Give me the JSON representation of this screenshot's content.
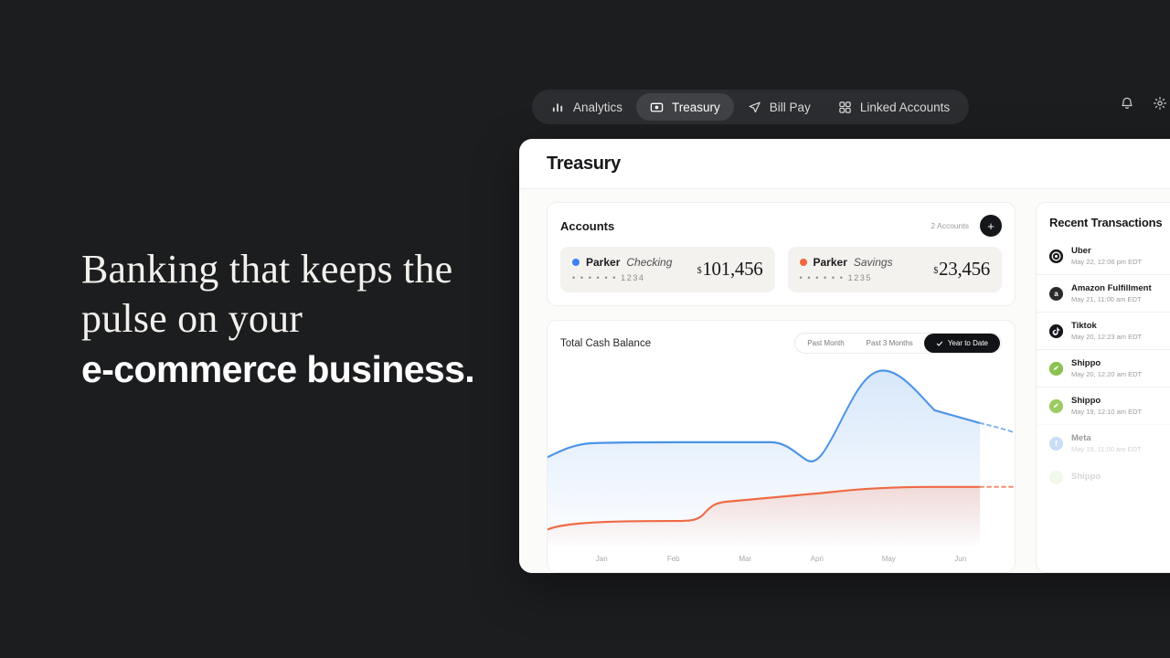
{
  "hero": {
    "line1": "Banking that keeps the",
    "line2": "pulse on your",
    "line3": "e-commerce business."
  },
  "nav": {
    "items": [
      {
        "label": "Analytics",
        "icon": "bar-chart-icon",
        "active": false
      },
      {
        "label": "Treasury",
        "icon": "card-icon",
        "active": true
      },
      {
        "label": "Bill Pay",
        "icon": "send-icon",
        "active": false
      },
      {
        "label": "Linked Accounts",
        "icon": "grid-icon",
        "active": false
      }
    ],
    "actions": [
      {
        "name": "notifications-button",
        "icon": "bell-icon"
      },
      {
        "name": "settings-button",
        "icon": "gear-icon"
      }
    ]
  },
  "page": {
    "title": "Treasury"
  },
  "accounts": {
    "heading": "Accounts",
    "count_label": "2 Accounts",
    "add_label": "+",
    "items": [
      {
        "owner": "Parker",
        "type": "Checking",
        "mask": "• • • • • • 1234",
        "currency": "$",
        "amount": "101,456",
        "color": "#3b82f6"
      },
      {
        "owner": "Parker",
        "type": "Savings",
        "mask": "• • • • • • 1235",
        "currency": "$",
        "amount": "23,456",
        "color": "#f4653c"
      }
    ]
  },
  "chart_data": {
    "type": "area",
    "title": "Total Cash Balance",
    "xlabel": "",
    "ylabel": "",
    "categories": [
      "Jan",
      "Feb",
      "Mar",
      "Apri",
      "May",
      "Jun"
    ],
    "grid": false,
    "legend": "none",
    "range_filters": [
      {
        "label": "Past Month",
        "active": false
      },
      {
        "label": "Past 3 Months",
        "active": false
      },
      {
        "label": "Year to Date",
        "active": true
      }
    ],
    "series": [
      {
        "name": "Parker Checking",
        "color": "#4b93e8",
        "values": [
          62,
          70,
          70,
          62,
          96,
          78
        ],
        "projected": [
          78,
          74
        ]
      },
      {
        "name": "Parker Savings",
        "color": "#ef6a45",
        "values": [
          19,
          20,
          27,
          30,
          34,
          35
        ],
        "projected": [
          35,
          35
        ]
      }
    ],
    "ylim": [
      0,
      100
    ]
  },
  "transactions": {
    "heading": "Recent Transactions",
    "items": [
      {
        "name": "Uber",
        "date": "May 22, 12:06 pm EDT",
        "icon": "uber-icon",
        "bg": "#1b1c1e",
        "amount": "$",
        "state": "normal"
      },
      {
        "name": "Amazon Fulfillment",
        "date": "May 21, 11:00 am EDT",
        "icon": "amazon-icon",
        "bg": "#2c2a28",
        "amount": "$",
        "state": "normal"
      },
      {
        "name": "Tiktok",
        "date": "May 20, 12:23 am EDT",
        "icon": "tiktok-icon",
        "bg": "#15161a",
        "amount": "$",
        "state": "normal"
      },
      {
        "name": "Shippo",
        "date": "May 20, 12:20 am EDT",
        "icon": "shippo-icon",
        "bg": "#8cc152",
        "amount": "$",
        "state": "normal"
      },
      {
        "name": "Shippo",
        "date": "May 19, 12:10 am EDT",
        "icon": "shippo-icon",
        "bg": "#9ccb63",
        "amount": "$",
        "state": "normal"
      },
      {
        "name": "Meta",
        "date": "May 19, 11:00 am EDT",
        "icon": "meta-icon",
        "bg": "#8ab4e8",
        "amount": "$",
        "state": "faded"
      },
      {
        "name": "Shippo",
        "date": "",
        "icon": "shippo-icon",
        "bg": "#bcd99a",
        "amount": "",
        "state": "faded2"
      }
    ]
  }
}
